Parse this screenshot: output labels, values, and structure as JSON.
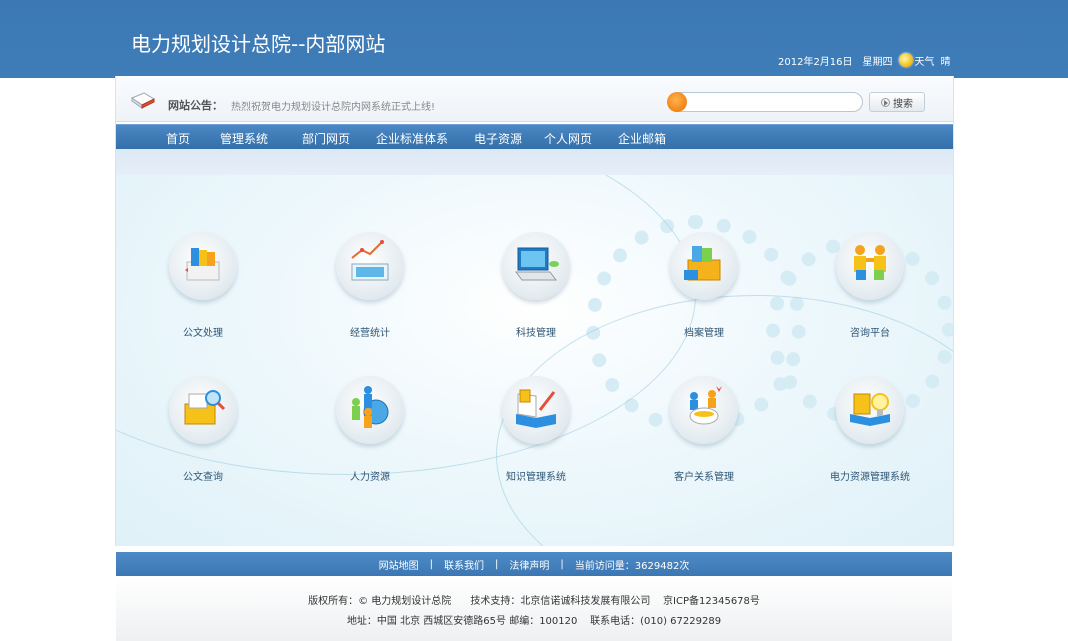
{
  "header": {
    "title": "电力规划设计总院--内部网站",
    "date": "2012年2月16日",
    "weekday": "星期四",
    "weather_label": "天气",
    "weather_value": "晴"
  },
  "notice": {
    "label": "网站公告：",
    "text": "热烈祝贺电力规划设计总院内网系统正式上线!"
  },
  "search": {
    "placeholder": "",
    "button_label": "搜索"
  },
  "nav": {
    "items": [
      "首页",
      "管理系统",
      "部门网页",
      "企业标准体系",
      "电子资源",
      "个人网页",
      "企业邮箱"
    ]
  },
  "apps": [
    {
      "label": "公文处理",
      "icon": "document-processing-icon"
    },
    {
      "label": "经营统计",
      "icon": "business-statistics-icon"
    },
    {
      "label": "科技管理",
      "icon": "technology-management-icon"
    },
    {
      "label": "档案管理",
      "icon": "archive-management-icon"
    },
    {
      "label": "咨询平台",
      "icon": "consulting-platform-icon"
    },
    {
      "label": "公文查询",
      "icon": "document-query-icon"
    },
    {
      "label": "人力资源",
      "icon": "human-resources-icon"
    },
    {
      "label": "知识管理系统",
      "icon": "knowledge-management-icon"
    },
    {
      "label": "客户关系管理",
      "icon": "customer-relations-icon"
    },
    {
      "label": "电力资源管理系统",
      "icon": "power-resource-management-icon"
    }
  ],
  "footer": {
    "links": [
      "网站地图",
      "联系我们",
      "法律声明"
    ],
    "visits_label": "当前访问量：",
    "visits": "3629482次",
    "copyright_line": "版权所有：© 电力规划设计总院      技术支持：北京信诺诚科技发展有限公司    京ICP备12345678号",
    "address_line": "地址：中国 北京 西城区安德路65号 邮编：100120    联系电话：(010) 67229289"
  },
  "colors": {
    "brand_blue": "#3f7db9",
    "nav_blue": "#346fa9",
    "search_orange": "#e97000"
  }
}
